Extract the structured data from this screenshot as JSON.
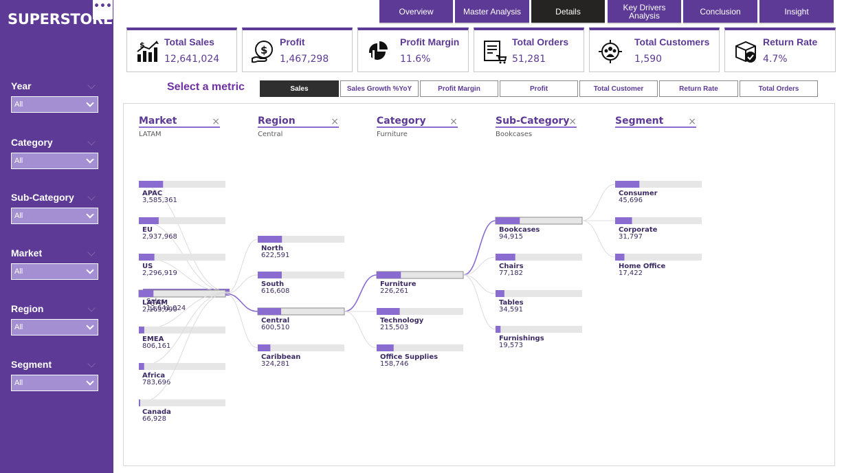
{
  "sidebar": {
    "logo": "SUPERSTORE",
    "more": "•••",
    "filters": [
      {
        "label": "Year",
        "value": "All"
      },
      {
        "label": "Category",
        "value": "All"
      },
      {
        "label": "Sub-Category",
        "value": "All"
      },
      {
        "label": "Market",
        "value": "All"
      },
      {
        "label": "Region",
        "value": "All"
      },
      {
        "label": "Segment",
        "value": "All"
      }
    ]
  },
  "nav": [
    {
      "label": "Overview",
      "active": false
    },
    {
      "label": "Master Analysis",
      "active": false
    },
    {
      "label": "Details",
      "active": true
    },
    {
      "label": "Key Drivers Analysis",
      "active": false
    },
    {
      "label": "Conclusion",
      "active": false
    },
    {
      "label": "Insight",
      "active": false
    }
  ],
  "kpis": [
    {
      "title": "Total Sales",
      "value": "12,641,024",
      "icon": "sales-chart-icon"
    },
    {
      "title": "Profit",
      "value": "1,467,298",
      "icon": "money-bag-icon"
    },
    {
      "title": "Profit Margin",
      "value": "11.6%",
      "icon": "pie-chart-icon"
    },
    {
      "title": "Total Orders",
      "value": "51,281",
      "icon": "order-list-icon"
    },
    {
      "title": "Total Customers",
      "value": "1,590",
      "icon": "customers-group-icon"
    },
    {
      "title": "Return Rate",
      "value": "4.7%",
      "icon": "return-box-icon"
    }
  ],
  "metric_selector": {
    "label": "Select a metric",
    "options": [
      {
        "label": "Sales",
        "active": true
      },
      {
        "label": "Sales Growth %YoY",
        "active": false
      },
      {
        "label": "Profit Margin",
        "active": false
      },
      {
        "label": "Profit",
        "active": false
      },
      {
        "label": "Total Customer",
        "active": false
      },
      {
        "label": "Return Rate",
        "active": false
      },
      {
        "label": "Total Orders",
        "active": false
      }
    ]
  },
  "tree": {
    "accent": "#8a6cd1",
    "track": "#e6e6e6",
    "root": {
      "label": "Sales",
      "value": 12641024,
      "display": "12,641,024"
    },
    "levels": [
      {
        "header": "Market",
        "selection": "LATAM",
        "close": "×",
        "nodes": [
          {
            "label": "APAC",
            "value": 3585361,
            "display": "3,585,361"
          },
          {
            "label": "EU",
            "value": 2937968,
            "display": "2,937,968"
          },
          {
            "label": "US",
            "value": 2296919,
            "display": "2,296,919"
          },
          {
            "label": "LATAM",
            "value": 2163990,
            "display": "2,163,990",
            "selected": true
          },
          {
            "label": "EMEA",
            "value": 806161,
            "display": "806,161"
          },
          {
            "label": "Africa",
            "value": 783696,
            "display": "783,696"
          },
          {
            "label": "Canada",
            "value": 66928,
            "display": "66,928"
          }
        ]
      },
      {
        "header": "Region",
        "selection": "Central",
        "close": "×",
        "nodes": [
          {
            "label": "North",
            "value": 622591,
            "display": "622,591"
          },
          {
            "label": "South",
            "value": 616608,
            "display": "616,608"
          },
          {
            "label": "Central",
            "value": 600510,
            "display": "600,510",
            "selected": true
          },
          {
            "label": "Caribbean",
            "value": 324281,
            "display": "324,281"
          }
        ]
      },
      {
        "header": "Category",
        "selection": "Furniture",
        "close": "×",
        "nodes": [
          {
            "label": "Furniture",
            "value": 226261,
            "display": "226,261",
            "selected": true
          },
          {
            "label": "Technology",
            "value": 215503,
            "display": "215,503"
          },
          {
            "label": "Office Supplies",
            "value": 158746,
            "display": "158,746"
          }
        ]
      },
      {
        "header": "Sub-Category",
        "selection": "Bookcases",
        "close": "×",
        "nodes": [
          {
            "label": "Bookcases",
            "value": 94915,
            "display": "94,915",
            "selected": true
          },
          {
            "label": "Chairs",
            "value": 77182,
            "display": "77,182"
          },
          {
            "label": "Tables",
            "value": 34591,
            "display": "34,591"
          },
          {
            "label": "Furnishings",
            "value": 19573,
            "display": "19,573"
          }
        ]
      },
      {
        "header": "Segment",
        "selection": "",
        "close": "×",
        "nodes": [
          {
            "label": "Consumer",
            "value": 45696,
            "display": "45,696"
          },
          {
            "label": "Corporate",
            "value": 31797,
            "display": "31,797"
          },
          {
            "label": "Home Office",
            "value": 17422,
            "display": "17,422"
          }
        ]
      }
    ]
  }
}
